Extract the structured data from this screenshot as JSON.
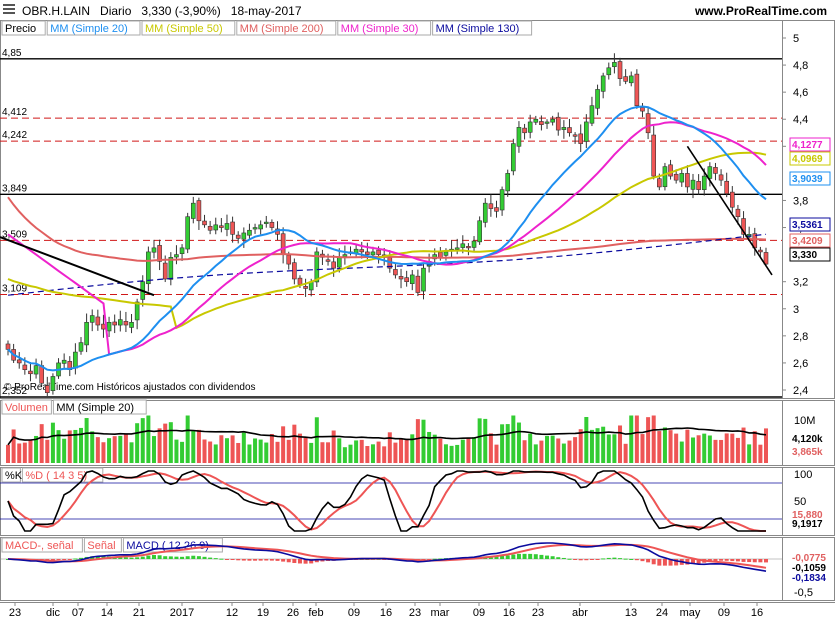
{
  "header": {
    "symbol": "OBR.H.LAIN",
    "period": "Diario",
    "quote": "3,330 (-3,90%)",
    "date": "18-may-2017",
    "site": "www.ProRealTime.com"
  },
  "colors": {
    "ma20": "#1e8ff0",
    "ma50": "#c8c800",
    "ma200": "#e06060",
    "ma30": "#ee22cc",
    "ma130": "#0b0b9e",
    "up": "#33cc33",
    "down": "#ee5555",
    "hline": "#d01818"
  },
  "price_panel": {
    "legend": [
      "Precio",
      "MM (Simple 20)",
      "MM (Simple 50)",
      "MM (Simple 200)",
      "MM (Simple 30)",
      "MM (Simple 130)"
    ],
    "copyright": "© ProRealTime.com  Históricos ajustados con dividendos",
    "left_levels": [
      "4,85",
      "4,412",
      "4,242",
      "3,849",
      "3,509",
      "3,109",
      "2,352"
    ],
    "right_ticks": [
      "5",
      "4,8",
      "4,6",
      "4,4",
      "4,2",
      "3,8",
      "3,6",
      "3,2",
      "3",
      "2,8",
      "2,6",
      "2,4"
    ],
    "right_labels": [
      {
        "text": "4,1277",
        "color": "#ee22cc"
      },
      {
        "text": "4,0969",
        "color": "#c8c800"
      },
      {
        "text": "3,9039",
        "color": "#1e8ff0"
      },
      {
        "text": "3,5361",
        "color": "#0b0b9e"
      },
      {
        "text": "3,4209",
        "color": "#e06060"
      },
      {
        "text": "3,330",
        "color": "#000000"
      }
    ]
  },
  "volume_panel": {
    "legend": [
      "Volumen",
      "MM (Simple 20)"
    ],
    "ticks": [
      "10M"
    ],
    "labels": [
      {
        "text": "4,120k",
        "color": "#000000"
      },
      {
        "text": "3,865k",
        "color": "#e06060"
      }
    ]
  },
  "stoch_panel": {
    "legend": [
      "%K",
      "%D ( 14 3 5)"
    ],
    "ticks": [
      "100",
      "50"
    ],
    "labels": [
      {
        "text": "15,880",
        "color": "#e06060"
      },
      {
        "text": "9,1917",
        "color": "#000000"
      }
    ]
  },
  "macd_panel": {
    "legend": [
      "MACD-, señal",
      "Señal",
      "MACD ( 12 26 9)"
    ],
    "ticks": [
      "-0,5"
    ],
    "labels": [
      {
        "text": "-0,0775",
        "color": "#e06060"
      },
      {
        "text": "-0,1059",
        "color": "#000000"
      },
      {
        "text": "-0,1834",
        "color": "#0b0b9e"
      }
    ]
  },
  "xaxis": [
    "23",
    "dic",
    "07",
    "14",
    "21",
    "2017",
    "12",
    "19",
    "26",
    "feb",
    "09",
    "16",
    "23",
    "mar",
    "09",
    "16",
    "23",
    "abr",
    "13",
    "24",
    "may",
    "09",
    "16"
  ],
  "chart_data": {
    "type": "candlestick",
    "title": "OBR.H.LAIN Diario",
    "x_range": [
      "23-nov-2016",
      "18-may-2017"
    ],
    "ylim": [
      2.3,
      5.05
    ],
    "horizontal_levels": [
      4.85,
      4.412,
      4.242,
      3.849,
      3.509,
      3.109,
      2.352
    ],
    "closes": [
      2.7,
      2.62,
      2.6,
      2.55,
      2.52,
      2.58,
      2.45,
      2.38,
      2.5,
      2.6,
      2.62,
      2.55,
      2.68,
      2.75,
      2.9,
      2.95,
      2.88,
      2.85,
      2.9,
      2.88,
      2.92,
      2.88,
      2.9,
      3.05,
      3.2,
      3.42,
      3.45,
      3.35,
      3.22,
      3.38,
      3.4,
      3.45,
      3.68,
      3.78,
      3.65,
      3.62,
      3.58,
      3.62,
      3.6,
      3.63,
      3.55,
      3.52,
      3.56,
      3.58,
      3.6,
      3.62,
      3.64,
      3.6,
      3.55,
      3.4,
      3.33,
      3.22,
      3.18,
      3.15,
      3.2,
      3.42,
      3.38,
      3.35,
      3.3,
      3.38,
      3.4,
      3.42,
      3.44,
      3.42,
      3.4,
      3.42,
      3.4,
      3.38,
      3.3,
      3.25,
      3.22,
      3.2,
      3.25,
      3.12,
      3.3,
      3.35,
      3.4,
      3.38,
      3.42,
      3.44,
      3.45,
      3.48,
      3.46,
      3.5,
      3.65,
      3.78,
      3.74,
      3.72,
      3.88,
      4.0,
      4.22,
      4.34,
      4.3,
      4.38,
      4.4,
      4.36,
      4.38,
      4.4,
      4.32,
      4.34,
      4.3,
      4.28,
      4.22,
      4.38,
      4.5,
      4.62,
      4.72,
      4.78,
      4.82,
      4.7,
      4.68,
      4.72,
      4.5,
      4.46,
      4.3,
      3.98,
      3.9,
      4.05,
      3.98,
      3.95,
      4.0,
      3.9,
      3.95,
      3.88,
      3.98,
      4.05,
      4.0,
      3.95,
      3.85,
      3.75,
      3.68,
      3.55,
      3.55,
      3.45,
      3.42,
      3.33
    ],
    "series": [
      {
        "name": "MM (Simple 20)",
        "last": 3.9039
      },
      {
        "name": "MM (Simple 50)",
        "last": 4.0969
      },
      {
        "name": "MM (Simple 200)",
        "last": 3.4209
      },
      {
        "name": "MM (Simple 30)",
        "last": 4.1277
      },
      {
        "name": "MM (Simple 130)",
        "last": 3.5361
      }
    ],
    "volume_ma_last": 4120,
    "volume_last": 3865,
    "stochastic": {
      "k_last": 9.1917,
      "d_last": 15.88
    },
    "macd": {
      "macd_last": -0.1834,
      "signal_last": -0.0775,
      "histogram_last": -0.1059
    }
  }
}
